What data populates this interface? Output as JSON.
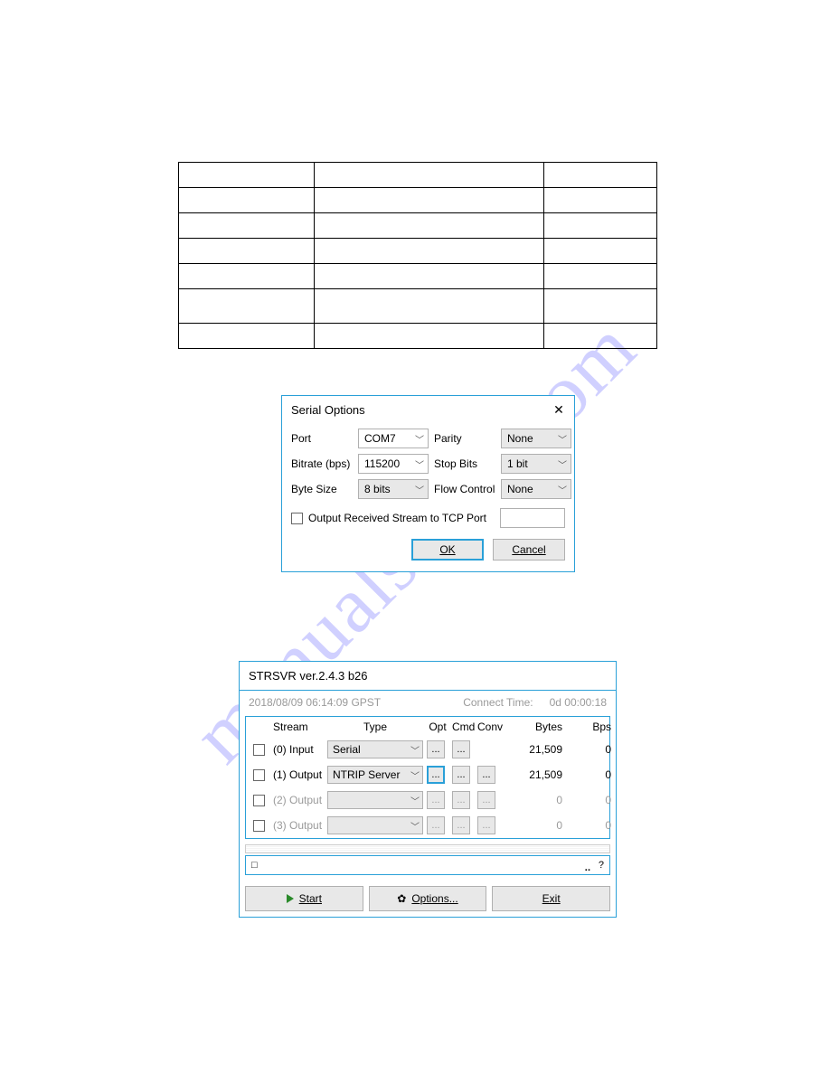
{
  "watermark": "manualshive.com",
  "serial_dialog": {
    "title": "Serial Options",
    "fields": {
      "port_label": "Port",
      "port_value": "COM7",
      "bitrate_label": "Bitrate (bps)",
      "bitrate_value": "115200",
      "bytesize_label": "Byte Size",
      "bytesize_value": "8 bits",
      "parity_label": "Parity",
      "parity_value": "None",
      "stopbits_label": "Stop Bits",
      "stopbits_value": "1 bit",
      "flowctl_label": "Flow Control",
      "flowctl_value": "None"
    },
    "output_checkbox_label": "Output Received Stream to  TCP Port",
    "ok_label": "OK",
    "cancel_label": "Cancel"
  },
  "strsvr": {
    "title": "STRSVR ver.2.4.3 b26",
    "timestamp": "2018/08/09 06:14:09 GPST",
    "connect_time_label": "Connect Time:",
    "connect_time_value": "0d 00:00:18",
    "headers": {
      "stream": "Stream",
      "type": "Type",
      "opt": "Opt",
      "cmd": "Cmd",
      "conv": "Conv",
      "bytes": "Bytes",
      "bps": "Bps"
    },
    "rows": [
      {
        "label": "(0) Input",
        "type": "Serial",
        "bytes": "21,509",
        "bps": "0",
        "dim": false,
        "opt_hl": false,
        "has_conv": false
      },
      {
        "label": "(1) Output",
        "type": "NTRIP Server",
        "bytes": "21,509",
        "bps": "0",
        "dim": false,
        "opt_hl": true,
        "has_conv": true
      },
      {
        "label": "(2) Output",
        "type": "",
        "bytes": "0",
        "bps": "0",
        "dim": true,
        "opt_hl": false,
        "has_conv": true
      },
      {
        "label": "(3) Output",
        "type": "",
        "bytes": "0",
        "bps": "0",
        "dim": true,
        "opt_hl": false,
        "has_conv": true
      }
    ],
    "info_left": "□",
    "info_right": "?",
    "buttons": {
      "start": "Start",
      "options": "Options...",
      "exit": "Exit"
    }
  }
}
